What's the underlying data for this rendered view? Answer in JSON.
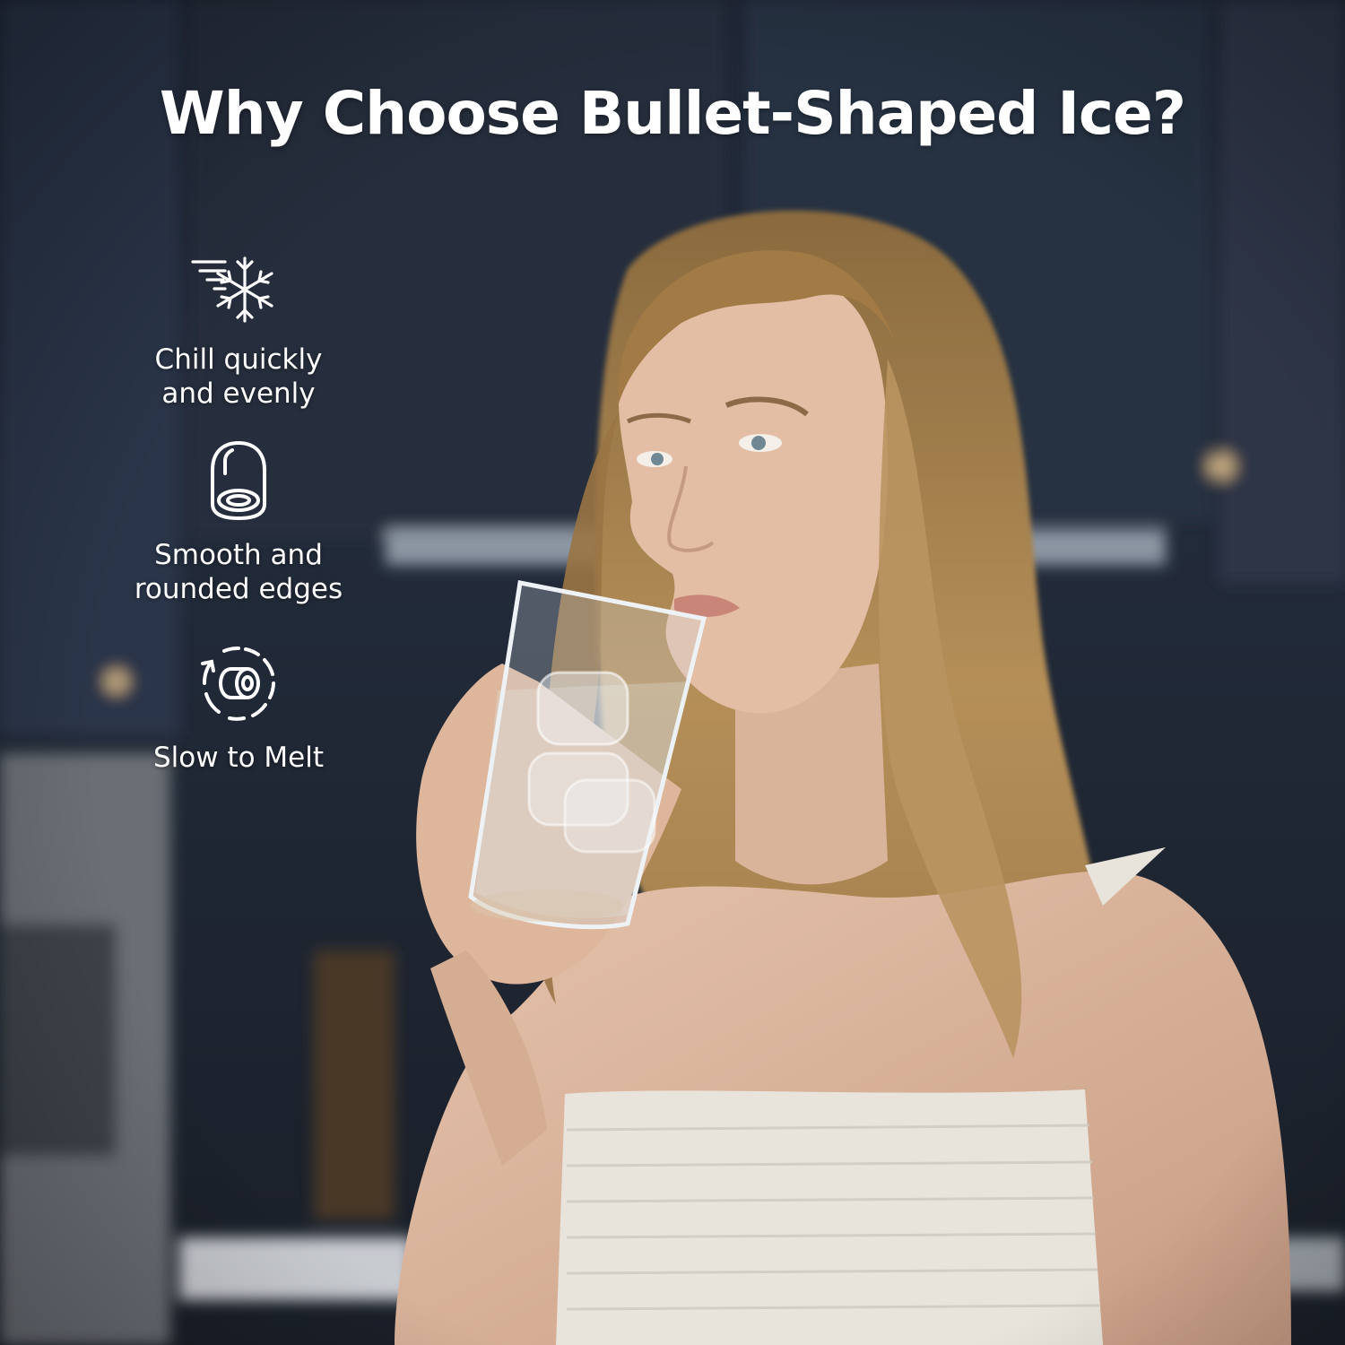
{
  "headline": "Why Choose Bullet-Shaped Ice?",
  "features": [
    {
      "icon": "snowflake-icon",
      "label": "Chill quickly\nand evenly"
    },
    {
      "icon": "bullet-ice-icon",
      "label": "Smooth and\nrounded edges"
    },
    {
      "icon": "slow-melt-icon",
      "label": "Slow to Melt"
    }
  ],
  "colors": {
    "background": "#1e2533",
    "text": "#ffffff"
  }
}
